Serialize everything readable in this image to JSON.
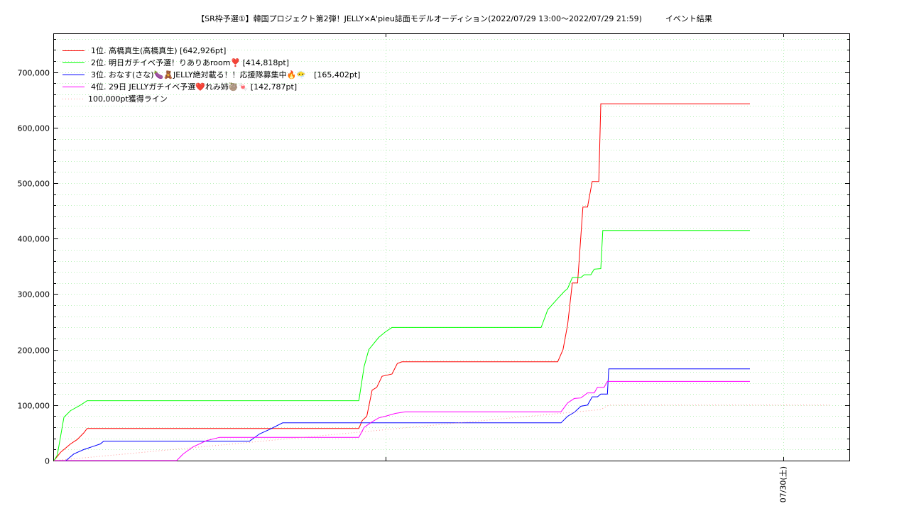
{
  "chart_data": {
    "type": "line",
    "title": "【SR枠予選①】韓国プロジェクト第2弾！JELLY×A'pieu誌面モデルオーディション(2022/07/29 13:00〜2022/07/29 21:59)　　　イベント結果",
    "xlabel": "",
    "ylabel": "",
    "ylim": [
      0,
      770000
    ],
    "yticks": [
      0,
      100000,
      200000,
      300000,
      400000,
      500000,
      600000,
      700000
    ],
    "ytick_labels": [
      "0",
      "100,000",
      "200,000",
      "300,000",
      "400,000",
      "500,000",
      "600,000",
      "700,000"
    ],
    "x_unit": "hours since 2022/07/29 13:00",
    "xlim": [
      0,
      12
    ],
    "xtick_labels": [
      {
        "x": 11,
        "label": "07/30(土)"
      }
    ],
    "grid": true,
    "legend_position": "top-left",
    "series": [
      {
        "name": "1位. 高橋真生(高橋真生) [642,926pt]",
        "color": "#ff0000",
        "dash": "",
        "points": [
          [
            0,
            0
          ],
          [
            0.1,
            15000
          ],
          [
            0.25,
            30000
          ],
          [
            0.35,
            38000
          ],
          [
            0.45,
            50000
          ],
          [
            0.5,
            58000
          ],
          [
            4.6,
            58000
          ],
          [
            4.65,
            72000
          ],
          [
            4.72,
            80000
          ],
          [
            4.8,
            127000
          ],
          [
            4.87,
            132000
          ],
          [
            4.95,
            152000
          ],
          [
            5.1,
            156000
          ],
          [
            5.18,
            175000
          ],
          [
            5.25,
            178000
          ],
          [
            7.6,
            178000
          ],
          [
            7.68,
            200000
          ],
          [
            7.75,
            245000
          ],
          [
            7.82,
            320000
          ],
          [
            7.9,
            320000
          ],
          [
            7.98,
            457000
          ],
          [
            8.05,
            457000
          ],
          [
            8.12,
            503000
          ],
          [
            8.22,
            503000
          ],
          [
            8.25,
            642926
          ],
          [
            10.5,
            642926
          ]
        ]
      },
      {
        "name": "2位. 明日ガチイベ予選！りありあroom❣️ [414,818pt]",
        "color": "#00ff00",
        "dash": "",
        "points": [
          [
            0,
            0
          ],
          [
            0.05,
            10000
          ],
          [
            0.15,
            78000
          ],
          [
            0.25,
            90000
          ],
          [
            0.4,
            100000
          ],
          [
            0.5,
            108000
          ],
          [
            4.6,
            108000
          ],
          [
            4.68,
            170000
          ],
          [
            4.75,
            200000
          ],
          [
            4.9,
            222000
          ],
          [
            5.0,
            232000
          ],
          [
            5.1,
            240000
          ],
          [
            7.35,
            240000
          ],
          [
            7.45,
            272000
          ],
          [
            7.6,
            292000
          ],
          [
            7.7,
            305000
          ],
          [
            7.75,
            310000
          ],
          [
            7.82,
            330000
          ],
          [
            7.95,
            330000
          ],
          [
            8.0,
            335000
          ],
          [
            8.1,
            335000
          ],
          [
            8.15,
            345000
          ],
          [
            8.25,
            346000
          ],
          [
            8.28,
            414818
          ],
          [
            10.5,
            414818
          ]
        ]
      },
      {
        "name": "3位. おなす(さな)🍆🧸JELLY絶対載る！！応援隊募集中🔥😶‍🌫️　[165,402pt]",
        "color": "#0000ff",
        "dash": "",
        "points": [
          [
            0,
            0
          ],
          [
            0.18,
            0
          ],
          [
            0.3,
            12000
          ],
          [
            0.45,
            20000
          ],
          [
            0.6,
            26000
          ],
          [
            0.7,
            30000
          ],
          [
            0.75,
            35000
          ],
          [
            2.95,
            35000
          ],
          [
            3.1,
            48000
          ],
          [
            3.25,
            56000
          ],
          [
            3.45,
            68000
          ],
          [
            7.65,
            68000
          ],
          [
            7.75,
            80000
          ],
          [
            7.85,
            87000
          ],
          [
            7.95,
            98000
          ],
          [
            8.05,
            100000
          ],
          [
            8.12,
            115000
          ],
          [
            8.2,
            115000
          ],
          [
            8.25,
            120000
          ],
          [
            8.35,
            120000
          ],
          [
            8.37,
            165402
          ],
          [
            10.5,
            165402
          ]
        ]
      },
      {
        "name": "4位. 29日 JELLYガチイベ予選❤️れみ姉🦥🍬 [142,787pt]",
        "color": "#ff00ff",
        "dash": "",
        "points": [
          [
            0,
            0
          ],
          [
            1.85,
            0
          ],
          [
            1.95,
            12000
          ],
          [
            2.1,
            25000
          ],
          [
            2.3,
            36000
          ],
          [
            2.5,
            42000
          ],
          [
            4.6,
            42000
          ],
          [
            4.68,
            60000
          ],
          [
            4.8,
            70000
          ],
          [
            4.9,
            77000
          ],
          [
            5.0,
            80000
          ],
          [
            5.15,
            85000
          ],
          [
            5.3,
            88000
          ],
          [
            7.65,
            88000
          ],
          [
            7.75,
            104000
          ],
          [
            7.85,
            112000
          ],
          [
            7.95,
            113000
          ],
          [
            8.05,
            122000
          ],
          [
            8.15,
            122000
          ],
          [
            8.2,
            132000
          ],
          [
            8.3,
            132000
          ],
          [
            8.35,
            142787
          ],
          [
            10.5,
            142787
          ]
        ]
      },
      {
        "name": "100,000pt獲得ライン",
        "color": "#ff9999",
        "dash": "1,3",
        "points": [
          [
            0,
            0
          ],
          [
            8.25,
            92000
          ],
          [
            8.37,
            100000
          ],
          [
            11.7,
            100000
          ]
        ]
      }
    ]
  }
}
